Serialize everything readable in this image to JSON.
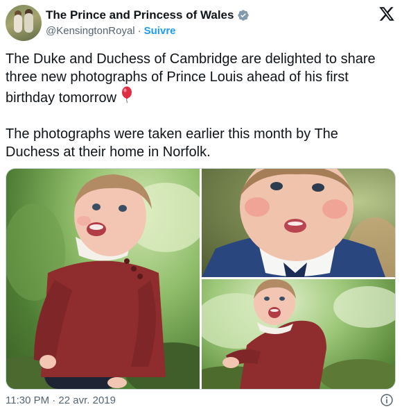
{
  "author": {
    "display_name": "The Prince and Princess of Wales",
    "handle": "@KensingtonRoyal",
    "separator": "·",
    "follow_label": "Suivre"
  },
  "tweet": {
    "paragraph1": "The Duke and Duchess of Cambridge are delighted to share three new photographs of Prince Louis ahead of his first birthday tomorrow",
    "paragraph2": "The photographs were taken earlier this month by The Duchess at their home in Norfolk."
  },
  "footer": {
    "timestamp": "11:30 PM · 22 avr. 2019"
  },
  "icons": {
    "verified": "verified-badge-icon",
    "platform": "x-logo-icon",
    "emoji": "balloon-icon",
    "info": "info-icon"
  },
  "colors": {
    "accent": "#1d9bf0",
    "text": "#0f1419",
    "muted": "#536471",
    "verified": "#829aab"
  }
}
